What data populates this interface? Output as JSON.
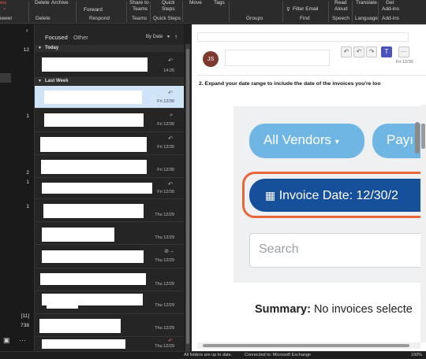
{
  "ribbon": {
    "top": {
      "delete": "Delete",
      "archive": "Archive",
      "forward": "Forward",
      "share_to": "Share to",
      "teams": "Teams",
      "quick": "Quick",
      "steps": "Steps",
      "move": "Move",
      "tags": "Tags",
      "filter_email": "Filter Email",
      "read": "Read",
      "aloud": "Aloud",
      "translate": "Translate",
      "get": "Get",
      "addins": "Add-ins",
      "iewer": "iewer"
    },
    "groups": {
      "delete": "Delete",
      "respond": "Respond",
      "teams": "Teams",
      "quick_steps": "Quick Steps",
      "groups": "Groups",
      "find": "Find",
      "speech": "Speech",
      "language": "Language",
      "addins": "Add-ins"
    }
  },
  "left_nav": {
    "counts": [
      "12",
      "1",
      "2",
      "1",
      "1",
      "[11]",
      "738"
    ],
    "more": "···"
  },
  "message_list": {
    "tabs": {
      "focused": "Focused",
      "other": "Other"
    },
    "sort": "By Date",
    "sections": {
      "today": "Today",
      "last_week": "Last Week"
    },
    "rows": [
      {
        "time": "14:26"
      },
      {
        "time": "Fri 12/30"
      },
      {
        "time": "Fri 12/30"
      },
      {
        "time": "Fri 12/30"
      },
      {
        "time": "Fri 12/30"
      },
      {
        "time": "Fri 12/30"
      },
      {
        "time": "Thu 12/29"
      },
      {
        "time": "Thu 12/29"
      },
      {
        "time": "Thu 12/29"
      },
      {
        "time": "Thu 12/29"
      },
      {
        "time": "Thu 12/29"
      },
      {
        "time": "Thu 12/29"
      },
      {
        "time": "Thu 12/29"
      }
    ]
  },
  "reading_pane": {
    "avatar_initials": "JS",
    "date": "Fri 12/30",
    "step_text": "2. Expand your date range to include the date of the invoices you're loo",
    "buttons": {
      "all_vendors": "All Vendors",
      "pay": "Payı",
      "invoice_date": "Invoice Date: 12/30/2"
    },
    "search_placeholder": "Search",
    "summary_label": "Summary:",
    "summary_text": " No invoices selecte"
  },
  "status": {
    "left": "All folders are up to date.",
    "right": "Connected to: Microsoft Exchange",
    "zoom": "100%"
  },
  "colors": {
    "accent": "#0f6cbd",
    "pill": "#6fb6e4",
    "invoice_pill": "#17509a",
    "invoice_border": "#e8673a"
  }
}
